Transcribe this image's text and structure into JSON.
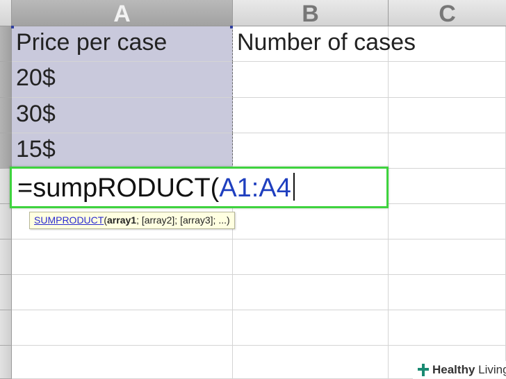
{
  "columns": [
    "A",
    "B",
    "C"
  ],
  "cells": {
    "a1": "Price per case",
    "b1": "Number of cases",
    "a2": "20$",
    "a3": "30$",
    "a4": "15$"
  },
  "editor": {
    "prefix": "=sumpRODUCT(",
    "reference": "A1:A4"
  },
  "tooltip": {
    "function_name": "SUMPRODUCT",
    "open_paren": "(",
    "arg1": "array1",
    "rest": "; [array2]; [array3]; ...)"
  },
  "watermark": {
    "bold": "Healthy",
    "regular": " Living"
  },
  "colors": {
    "selection": "#c9c9dc",
    "editor_border": "#3ed33e",
    "reference": "#1f3fbf",
    "tooltip_bg": "#ffffe1"
  },
  "icons": [
    "plus-cross-logo-icon"
  ]
}
